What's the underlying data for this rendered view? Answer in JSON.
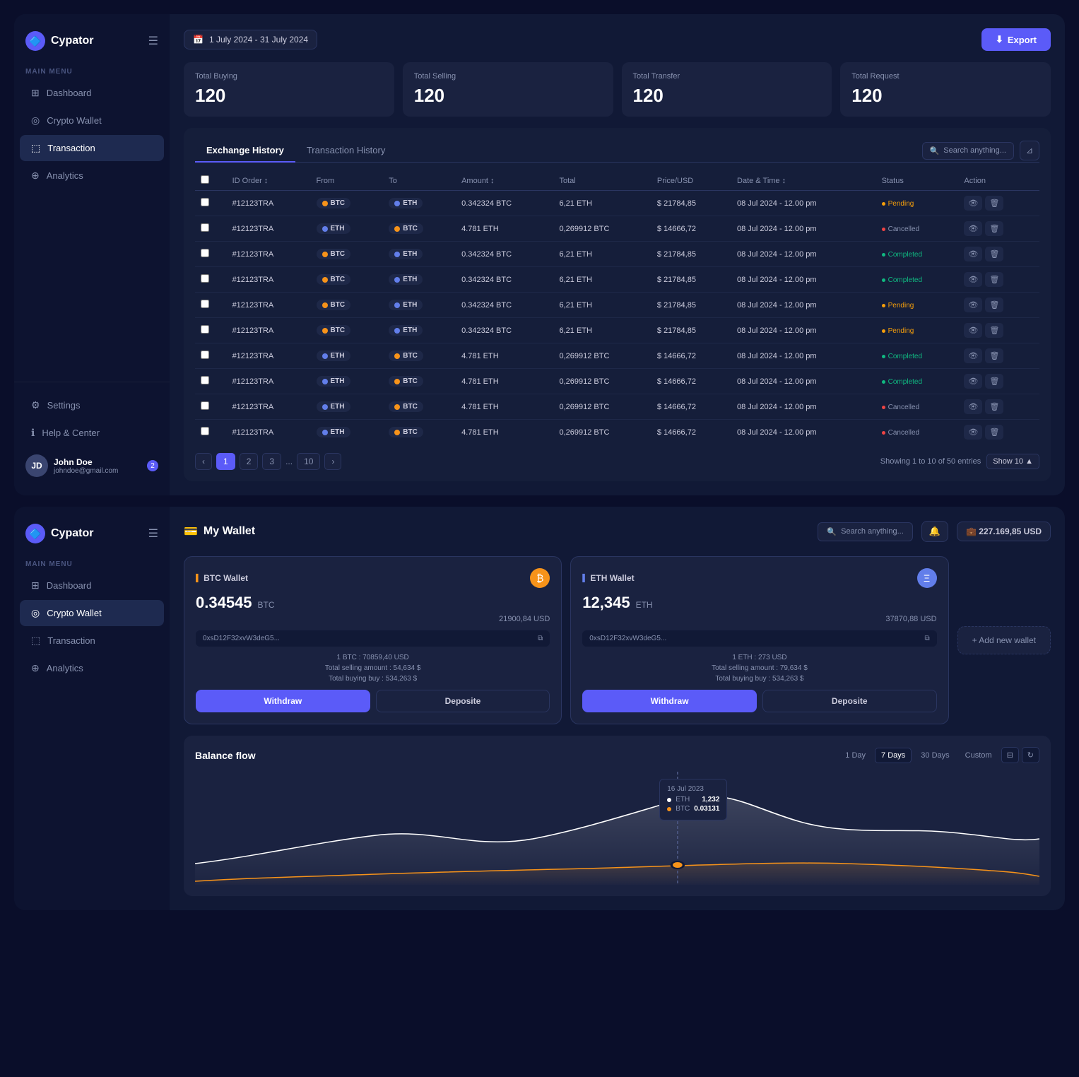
{
  "panel1": {
    "sidebar": {
      "logo": "Cypator",
      "section_label": "MAIN MENU",
      "items": [
        {
          "id": "dashboard",
          "label": "Dashboard",
          "icon": "⊞",
          "active": false
        },
        {
          "id": "crypto-wallet",
          "label": "Crypto Wallet",
          "icon": "◎",
          "active": false
        },
        {
          "id": "transaction",
          "label": "Transaction",
          "icon": "⬚",
          "active": true
        },
        {
          "id": "analytics",
          "label": "Analytics",
          "icon": "⊕",
          "active": false
        }
      ],
      "bottom_items": [
        {
          "id": "settings",
          "label": "Settings",
          "icon": "⚙"
        },
        {
          "id": "help",
          "label": "Help & Center",
          "icon": "ℹ"
        }
      ],
      "user": {
        "name": "John Doe",
        "email": "johndoe@gmail.com",
        "badge": "2",
        "initials": "JD"
      }
    },
    "topbar": {
      "date_range": "1 July 2024 - 31 July 2024",
      "export_label": "Export"
    },
    "stats": [
      {
        "label": "Total Buying",
        "value": "120"
      },
      {
        "label": "Total Selling",
        "value": "120"
      },
      {
        "label": "Total Transfer",
        "value": "120"
      },
      {
        "label": "Total Request",
        "value": "120"
      }
    ],
    "tabs": [
      {
        "label": "Exchange History",
        "active": true
      },
      {
        "label": "Transaction History",
        "active": false
      }
    ],
    "search_placeholder": "Search anything...",
    "table": {
      "columns": [
        "ID Order",
        "From",
        "To",
        "Amount",
        "Total",
        "Price/USD",
        "Date & Time",
        "Status",
        "Action"
      ],
      "rows": [
        {
          "id": "#12123TRA",
          "from": "BTC",
          "to": "ETH",
          "amount": "0.342324 BTC",
          "total": "6,21 ETH",
          "price": "$ 21784,85",
          "datetime": "08 Jul 2024 - 12.00 pm",
          "status": "Pending"
        },
        {
          "id": "#12123TRA",
          "from": "ETH",
          "to": "BTC",
          "amount": "4.781 ETH",
          "total": "0,269912 BTC",
          "price": "$ 14666,72",
          "datetime": "08 Jul 2024 - 12.00 pm",
          "status": "Cancelled"
        },
        {
          "id": "#12123TRA",
          "from": "BTC",
          "to": "ETH",
          "amount": "0.342324 BTC",
          "total": "6,21 ETH",
          "price": "$ 21784,85",
          "datetime": "08 Jul 2024 - 12.00 pm",
          "status": "Completed"
        },
        {
          "id": "#12123TRA",
          "from": "BTC",
          "to": "ETH",
          "amount": "0.342324 BTC",
          "total": "6,21 ETH",
          "price": "$ 21784,85",
          "datetime": "08 Jul 2024 - 12.00 pm",
          "status": "Completed"
        },
        {
          "id": "#12123TRA",
          "from": "BTC",
          "to": "ETH",
          "amount": "0.342324 BTC",
          "total": "6,21 ETH",
          "price": "$ 21784,85",
          "datetime": "08 Jul 2024 - 12.00 pm",
          "status": "Pending"
        },
        {
          "id": "#12123TRA",
          "from": "BTC",
          "to": "ETH",
          "amount": "0.342324 BTC",
          "total": "6,21 ETH",
          "price": "$ 21784,85",
          "datetime": "08 Jul 2024 - 12.00 pm",
          "status": "Pending"
        },
        {
          "id": "#12123TRA",
          "from": "ETH",
          "to": "BTC",
          "amount": "4.781 ETH",
          "total": "0,269912 BTC",
          "price": "$ 14666,72",
          "datetime": "08 Jul 2024 - 12.00 pm",
          "status": "Completed"
        },
        {
          "id": "#12123TRA",
          "from": "ETH",
          "to": "BTC",
          "amount": "4.781 ETH",
          "total": "0,269912 BTC",
          "price": "$ 14666,72",
          "datetime": "08 Jul 2024 - 12.00 pm",
          "status": "Completed"
        },
        {
          "id": "#12123TRA",
          "from": "ETH",
          "to": "BTC",
          "amount": "4.781 ETH",
          "total": "0,269912 BTC",
          "price": "$ 14666,72",
          "datetime": "08 Jul 2024 - 12.00 pm",
          "status": "Cancelled"
        },
        {
          "id": "#12123TRA",
          "from": "ETH",
          "to": "BTC",
          "amount": "4.781 ETH",
          "total": "0,269912 BTC",
          "price": "$ 14666,72",
          "datetime": "08 Jul 2024 - 12.00 pm",
          "status": "Cancelled"
        }
      ]
    },
    "pagination": {
      "pages": [
        "1",
        "2",
        "3",
        "...",
        "10"
      ],
      "info": "Showing 1 to 10 of 50 entries",
      "show_label": "Show 10"
    }
  },
  "panel2": {
    "sidebar": {
      "logo": "Cypator",
      "section_label": "MAIN MENU",
      "items": [
        {
          "id": "dashboard",
          "label": "Dashboard",
          "icon": "⊞",
          "active": false
        },
        {
          "id": "crypto-wallet",
          "label": "Crypto Wallet",
          "icon": "◎",
          "active": true
        },
        {
          "id": "transaction",
          "label": "Transaction",
          "icon": "⬚",
          "active": false
        },
        {
          "id": "analytics",
          "label": "Analytics",
          "icon": "⊕",
          "active": false
        }
      ]
    },
    "header": {
      "title": "My Wallet",
      "search_placeholder": "Search anything...",
      "balance": "227.169,85 USD"
    },
    "wallets": [
      {
        "type": "BTC",
        "label": "BTC Wallet",
        "amount": "0.34545",
        "unit": "BTC",
        "usd": "21900,84 USD",
        "address": "0xsD12F32xvW3deG5...",
        "rate": "1 BTC : 70859,40 USD",
        "selling": "Total selling amount : 54,634 $",
        "buying": "Total buying buy : 534,263 $",
        "withdraw_label": "Withdraw",
        "deposit_label": "Deposite"
      },
      {
        "type": "ETH",
        "label": "ETH Wallet",
        "amount": "12,345",
        "unit": "ETH",
        "usd": "37870,88 USD",
        "address": "0xsD12F32xvW3deG5...",
        "rate": "1 ETH : 273 USD",
        "selling": "Total selling amount : 79,634 $",
        "buying": "Total buying buy : 534,263 $",
        "withdraw_label": "Withdraw",
        "deposit_label": "Deposite"
      }
    ],
    "add_wallet_label": "+ Add new wallet",
    "balance_flow": {
      "title": "Balance flow",
      "time_filters": [
        "1 Day",
        "7 Days",
        "30 Days",
        "Custom"
      ],
      "active_filter": "7 Days",
      "tooltip": {
        "date": "16 Jul 2023",
        "eth_label": "ETH",
        "eth_value": "1,232",
        "btc_label": "BTC",
        "btc_value": "0.03131"
      }
    }
  }
}
